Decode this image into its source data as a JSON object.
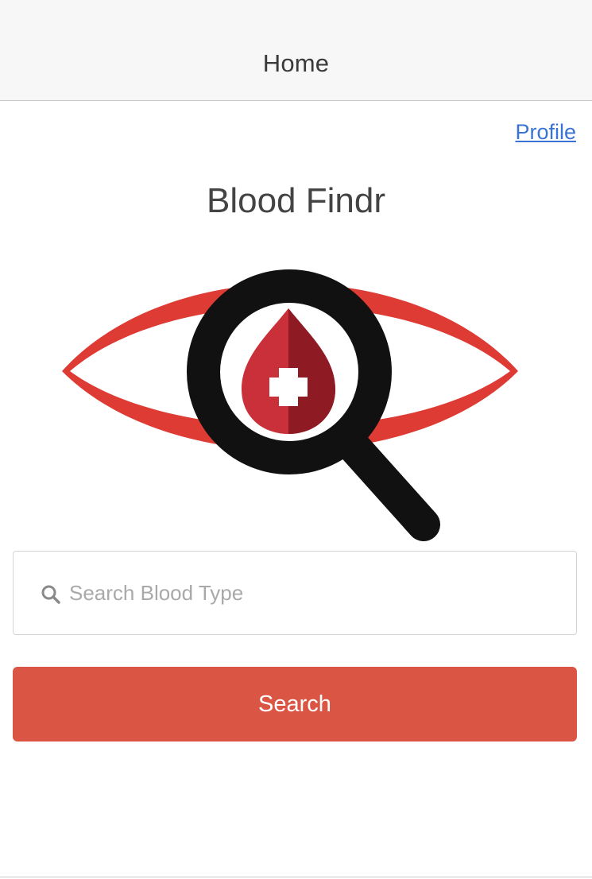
{
  "nav": {
    "title": "Home"
  },
  "profile_link": "Profile",
  "app_title": "Blood Findr",
  "logo": {
    "icon": "blood-findr-eye-magnifier-logo"
  },
  "search": {
    "placeholder": "Search Blood Type",
    "value": "",
    "icon": "search-icon"
  },
  "search_button": {
    "label": "Search"
  },
  "colors": {
    "accent": "#db5544",
    "link": "#3b73d4",
    "logo_red": "#dd3b33",
    "drop_red": "#c9303a",
    "drop_dark": "#8e1b23"
  }
}
